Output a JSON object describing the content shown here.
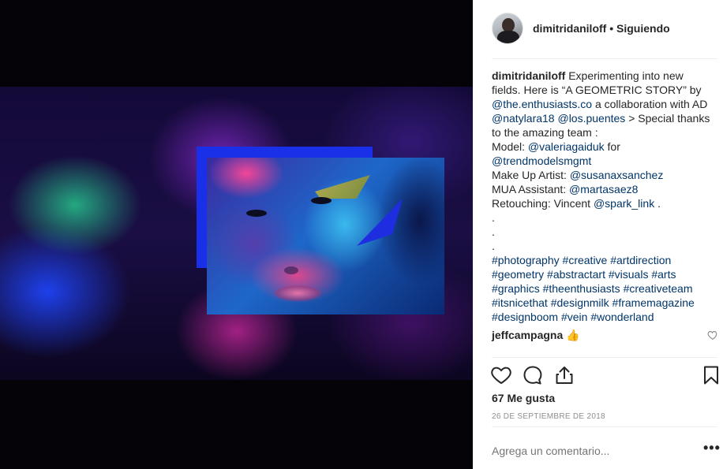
{
  "post": {
    "username": "dimitridaniloff",
    "separator": "•",
    "follow_status": "Siguiendo"
  },
  "caption": {
    "username": "dimitridaniloff",
    "lines": [
      "Experimenting into new",
      "fields. Here is “A GEOMETRIC STORY” by",
      "@the.enthusiasts.co",
      "a collaboration with AD",
      "@natylara18",
      "@los.puentes",
      "> Special thanks",
      "to the amazing team :",
      "Model:",
      "@valeriagaiduk",
      "for",
      "@trendmodelsmgmt",
      "Make Up Artist:",
      "@susanaxsanchez",
      "MUA Assistant:",
      "@martasaez8",
      "Retouching: Vincent",
      "@spark_link",
      ".",
      ".",
      ".",
      "."
    ],
    "hashtags": [
      [
        "#photography",
        "#creative",
        "#artdirection"
      ],
      [
        "#geometry",
        "#abstractart",
        "#visuals",
        "#arts"
      ],
      [
        "#graphics",
        "#theenthusiasts",
        "#creativeteam"
      ],
      [
        "#itsnicethat",
        "#designmilk",
        "#framemagazine"
      ],
      [
        "#designboom",
        "#vein",
        "#wonderland"
      ]
    ]
  },
  "comment": {
    "username": "jeffcampagna",
    "text": "👍"
  },
  "stats": {
    "likes": "67 Me gusta",
    "date": "26 DE SEPTIEMBRE DE 2018"
  },
  "composer": {
    "placeholder": "Agrega un comentario...",
    "more": "•••"
  },
  "icons": {
    "like": "heart-icon",
    "comment": "comment-bubble-icon",
    "share": "share-icon",
    "save": "bookmark-icon",
    "comment_like": "heart-icon"
  },
  "colors": {
    "link": "#003569",
    "text": "#262626",
    "muted": "#8e8e8e",
    "divider": "#efefef"
  }
}
